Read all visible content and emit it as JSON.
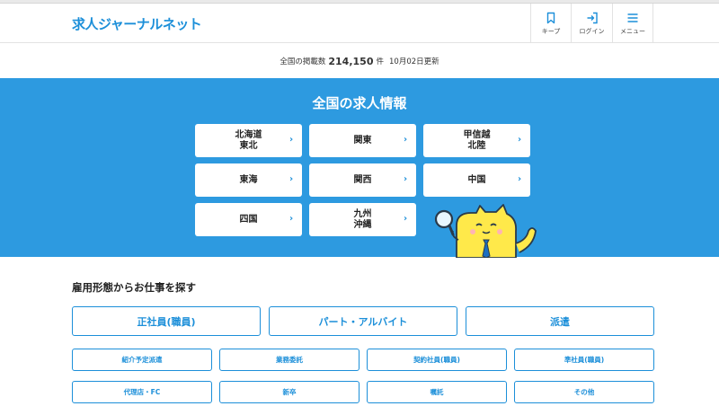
{
  "header": {
    "logo": "求人ジャーナルネット",
    "nav": [
      {
        "label": "キープ",
        "icon": "bookmark-icon"
      },
      {
        "label": "ログイン",
        "icon": "login-icon"
      },
      {
        "label": "メニュー",
        "icon": "menu-icon"
      }
    ]
  },
  "listing_count": {
    "prefix": "全国の掲載数",
    "count": "214,150",
    "unit": "件",
    "updated": "10月02日更新"
  },
  "regions": {
    "title": "全国の求人情報",
    "items": [
      {
        "label": "北海道\n東北"
      },
      {
        "label": "関東"
      },
      {
        "label": "甲信越\n北陸"
      },
      {
        "label": "東海"
      },
      {
        "label": "関西"
      },
      {
        "label": "中国"
      },
      {
        "label": "四国"
      },
      {
        "label": "九州\n沖縄"
      }
    ]
  },
  "employment": {
    "title": "雇用形態からお仕事を探す",
    "primary": [
      {
        "label": "正社員(職員)"
      },
      {
        "label": "パート・アルバイト"
      },
      {
        "label": "派遣"
      }
    ],
    "secondary": [
      {
        "label": "紹介予定派遣"
      },
      {
        "label": "業務委託"
      },
      {
        "label": "契約社員(職員)"
      },
      {
        "label": "準社員(職員)"
      },
      {
        "label": "代理店・FC"
      },
      {
        "label": "新卒"
      },
      {
        "label": "嘱託"
      },
      {
        "label": "その他"
      }
    ]
  },
  "colors": {
    "brand": "#1c8fd9",
    "hero_bg": "#2d9ae0",
    "mascot": "#ffe94a"
  }
}
